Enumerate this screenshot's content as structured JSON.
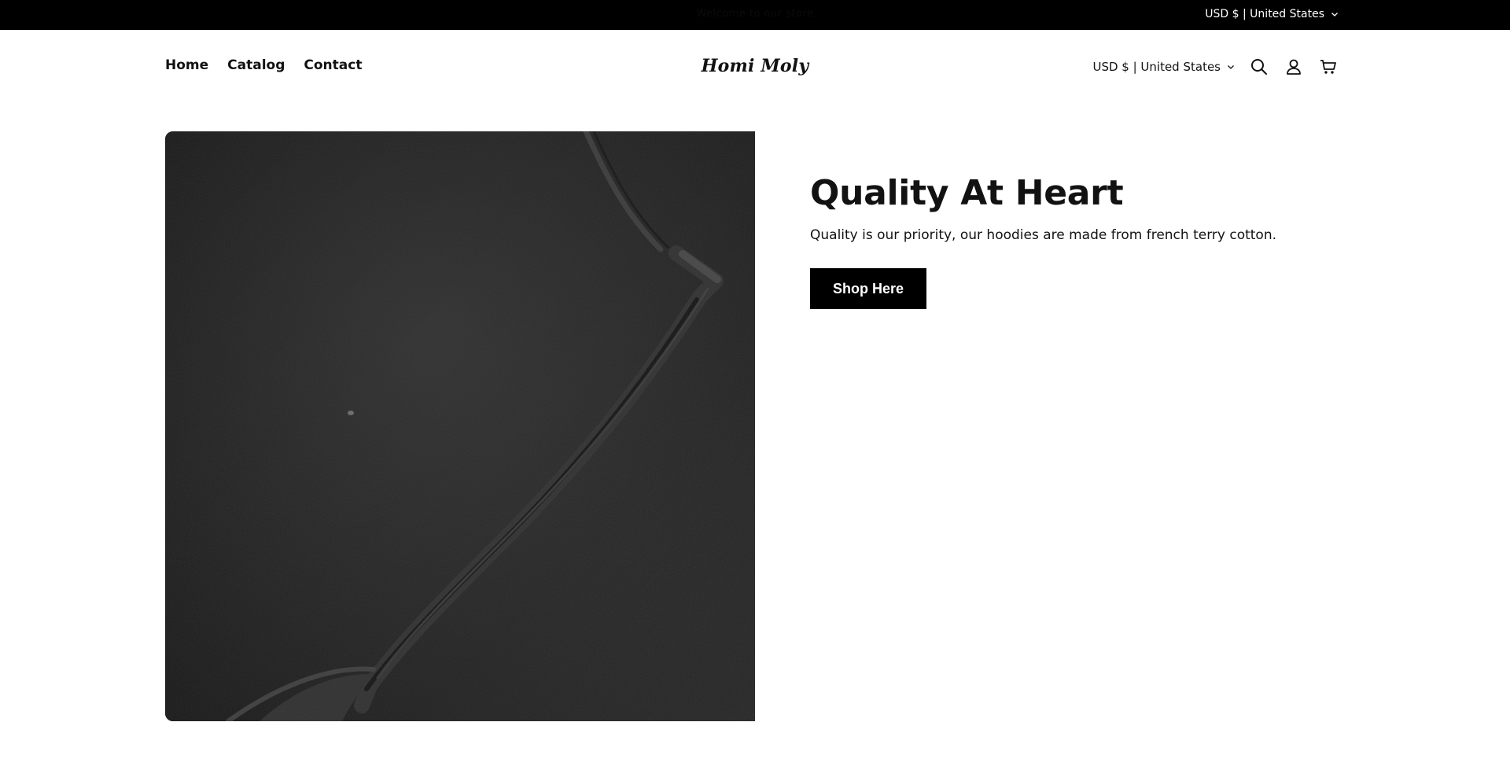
{
  "announcement": {
    "text": "Welcome to our store",
    "localization": "USD $ | United States"
  },
  "header": {
    "nav": [
      {
        "label": "Home"
      },
      {
        "label": "Catalog"
      },
      {
        "label": "Contact"
      }
    ],
    "logo_text": "Homi Moly",
    "localization": "USD $ | United States",
    "icons": [
      "search-icon",
      "account-icon",
      "cart-icon"
    ]
  },
  "hero": {
    "heading": "Quality At Heart",
    "subtext": "Quality is our priority, our hoodies are made from french terry cotton.",
    "button_label": "Shop Here"
  },
  "colors": {
    "announcement_bg": "#000000",
    "button_bg": "#000000",
    "text": "#121212",
    "background": "#ffffff"
  }
}
